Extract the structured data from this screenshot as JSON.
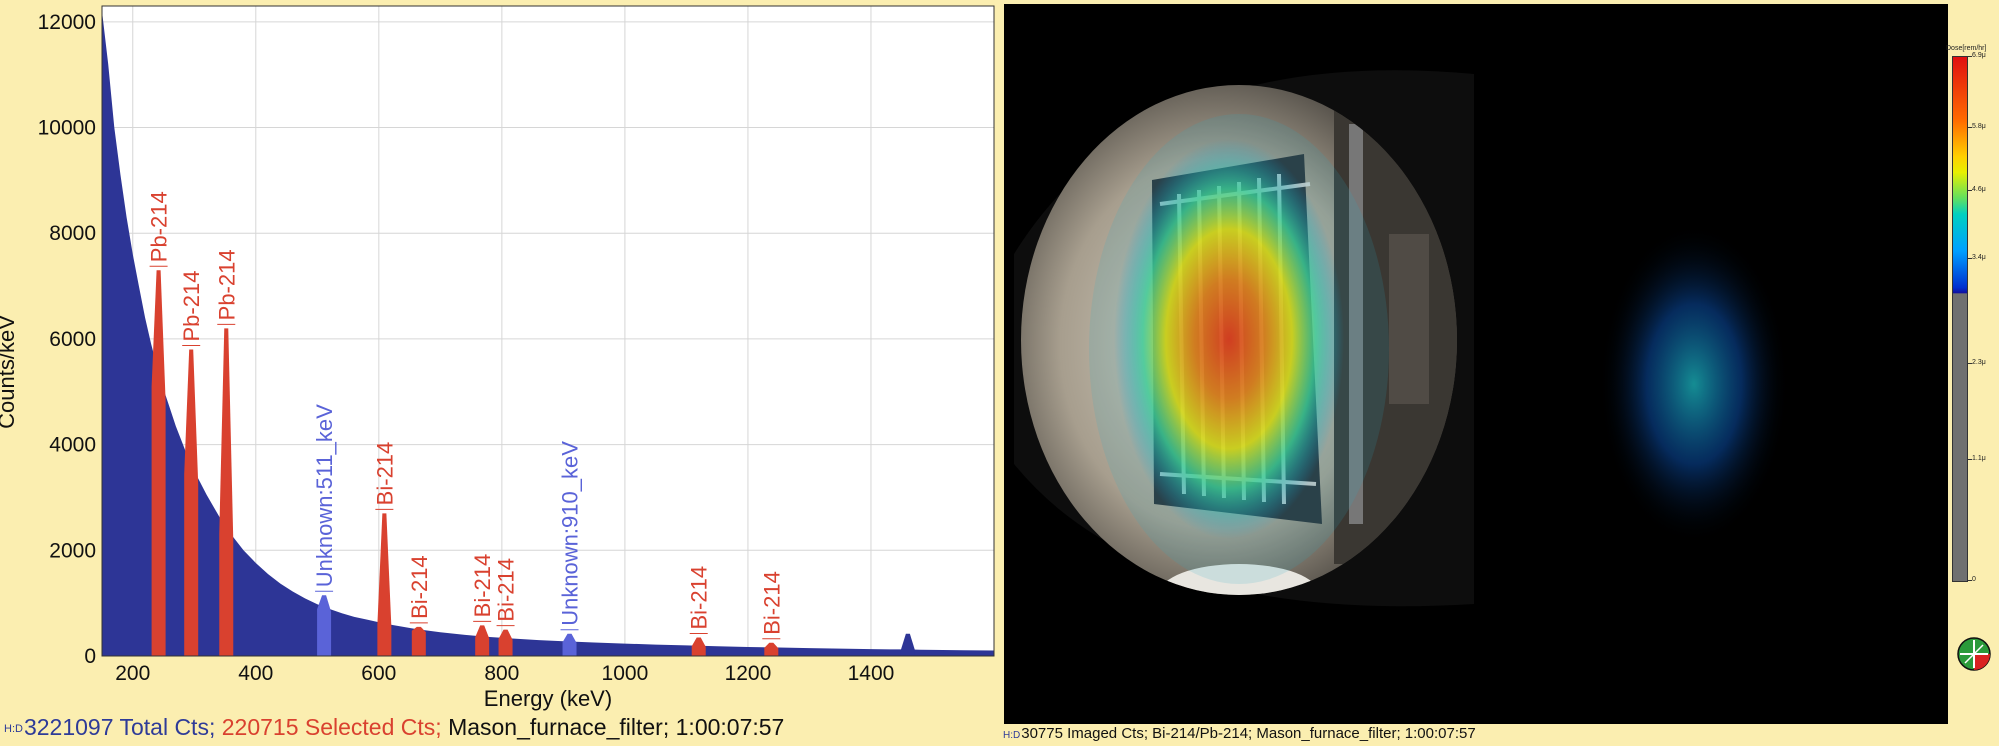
{
  "spectrum": {
    "chart_data": {
      "type": "area",
      "xlabel": "Energy (keV)",
      "ylabel": "Counts/keV",
      "xlim": [
        150,
        1600
      ],
      "ylim": [
        0,
        12300
      ],
      "x_ticks": [
        "200",
        "400",
        "600",
        "800",
        "1000",
        "1200",
        "1400"
      ],
      "y_ticks": [
        "0",
        "2000",
        "4000",
        "6000",
        "8000",
        "10000",
        "12000"
      ],
      "grid": true,
      "series": [
        {
          "x": [
            150,
            160,
            170,
            180,
            190,
            200,
            210,
            220,
            230,
            240,
            250,
            260,
            270,
            280,
            290,
            300,
            320,
            340,
            360,
            380,
            400,
            420,
            440,
            460,
            480,
            500,
            520,
            540,
            560,
            580,
            600,
            620,
            640,
            660,
            680,
            700,
            740,
            780,
            820,
            860,
            900,
            950,
            1000,
            1050,
            1100,
            1150,
            1200,
            1250,
            1300,
            1350,
            1400,
            1440,
            1460,
            1480,
            1500,
            1550,
            1600
          ],
          "y": [
            12200,
            11200,
            10000,
            9100,
            8300,
            7600,
            7000,
            6400,
            5900,
            5450,
            5050,
            4700,
            4350,
            4050,
            3750,
            3500,
            3050,
            2650,
            2300,
            2000,
            1760,
            1550,
            1370,
            1220,
            1090,
            980,
            890,
            810,
            740,
            690,
            640,
            590,
            550,
            510,
            480,
            450,
            400,
            360,
            330,
            300,
            280,
            255,
            235,
            215,
            200,
            185,
            170,
            160,
            150,
            140,
            130,
            125,
            125,
            120,
            115,
            110,
            105
          ],
          "color": "#2d3596"
        }
      ],
      "peaks": [
        {
          "energy": 242,
          "height": 7300,
          "label": "Pb-214",
          "color": "#d9412f"
        },
        {
          "energy": 295,
          "height": 5800,
          "label": "Pb-214",
          "color": "#d9412f"
        },
        {
          "energy": 352,
          "height": 6200,
          "label": "Pb-214",
          "color": "#d9412f"
        },
        {
          "energy": 511,
          "height": 1150,
          "label": "Unknown:511_keV",
          "color": "#5a63d8"
        },
        {
          "energy": 609,
          "height": 2700,
          "label": "Bi-214",
          "color": "#d9412f"
        },
        {
          "energy": 665,
          "height": 550,
          "label": "Bi-214",
          "color": "#d9412f"
        },
        {
          "energy": 768,
          "height": 580,
          "label": "Bi-214",
          "color": "#d9412f"
        },
        {
          "energy": 806,
          "height": 500,
          "label": "Bi-214",
          "color": "#d9412f"
        },
        {
          "energy": 910,
          "height": 420,
          "label": "Unknown:910_keV",
          "color": "#5a63d8"
        },
        {
          "energy": 1120,
          "height": 350,
          "label": "Bi-214",
          "color": "#d9412f"
        },
        {
          "energy": 1238,
          "height": 250,
          "label": "Bi-214",
          "color": "#d9412f"
        },
        {
          "energy": 1460,
          "height": 420,
          "label": "",
          "color": "#2d3596"
        }
      ]
    }
  },
  "status_left": {
    "hd": "H:D",
    "total": "3221097 Total Cts;",
    "selected": "220715 Selected Cts;",
    "file": "Mason_furnace_filter;",
    "time": "1:00:07:57",
    "colors": {
      "total": "#2e3b98",
      "selected": "#d9412f",
      "file": "#111111"
    }
  },
  "status_right": {
    "hd": "H:D",
    "text": "30775 Imaged Cts; Bi-214/Pb-214; Mason_furnace_filter; 1:00:07:57"
  },
  "colorbar": {
    "title": "Dose[rem/hr]",
    "labels": [
      "6.9μ",
      "5.8μ",
      "4.6μ",
      "3.4μ",
      "2.3μ",
      "1.1μ",
      "0"
    ]
  },
  "icons": {
    "compass": "compass-icon"
  }
}
